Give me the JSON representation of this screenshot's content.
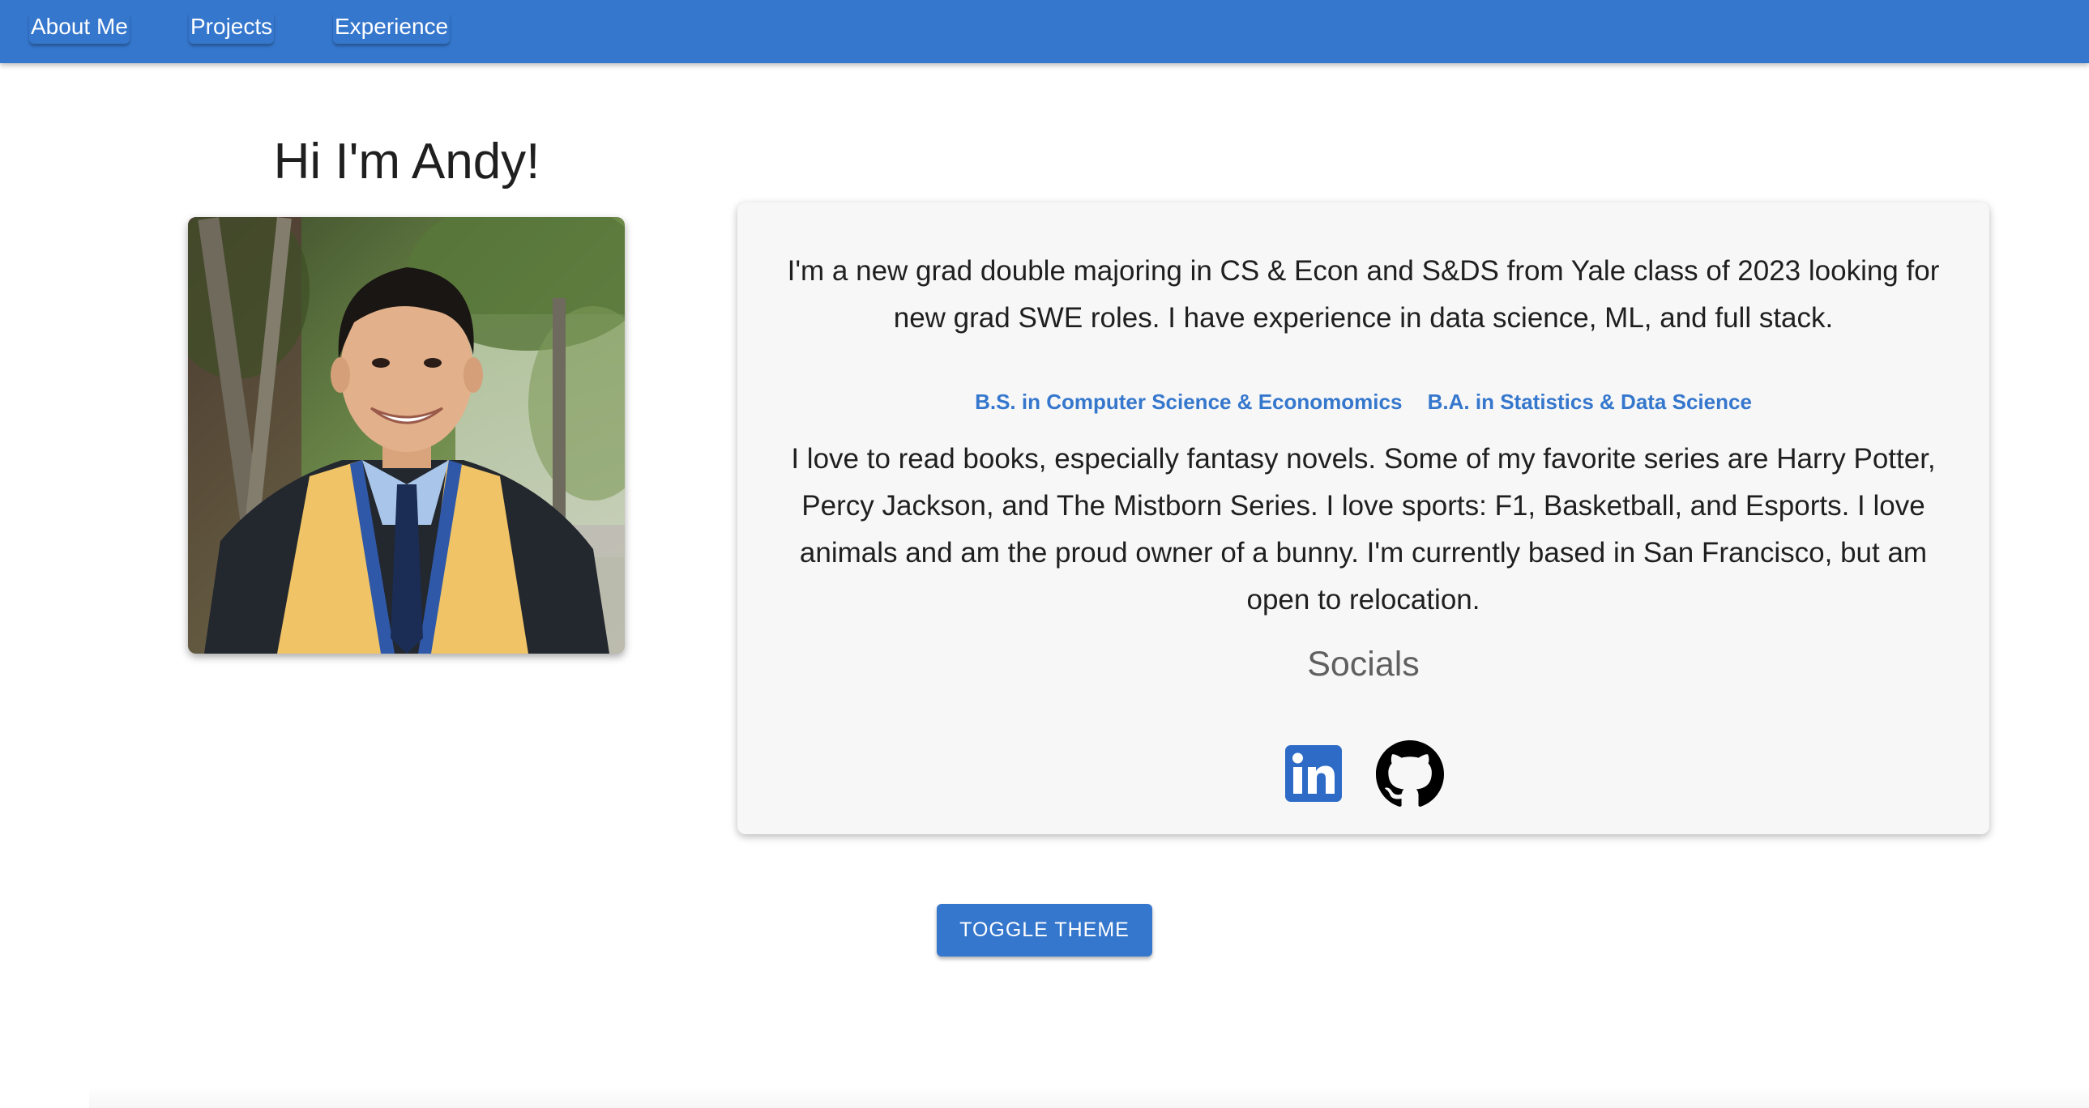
{
  "nav": {
    "items": [
      {
        "label": "About Me"
      },
      {
        "label": "Projects"
      },
      {
        "label": "Experience"
      }
    ]
  },
  "profile": {
    "greeting": "Hi I'm Andy!",
    "photo_alt": "Graduation portrait"
  },
  "about": {
    "intro": "I'm a new grad double majoring in CS & Econ and S&DS from Yale class of 2023 looking for new grad SWE roles. I have experience in data science, ML, and full stack.",
    "degrees": [
      "B.S. in Computer Science & Economomics",
      "B.A. in Statistics & Data Science"
    ],
    "bio": "I love to read books, especially fantasy novels. Some of my favorite series are Harry Potter, Percy Jackson, and The Mistborn Series. I love sports: F1, Basketball, and Esports. I love animals and am the proud owner of a bunny. I'm currently based in San Francisco, but am open to relocation.",
    "socials_title": "Socials",
    "socials": [
      {
        "icon": "linkedin-icon",
        "color": "#2e6bc7"
      },
      {
        "icon": "github-icon",
        "color": "#000000"
      }
    ]
  },
  "actions": {
    "toggle_theme_label": "TOGGLE THEME"
  },
  "colors": {
    "primary": "#3577cd",
    "card_background": "#f7f7f7",
    "text": "#1f1f1f",
    "muted_text": "#606060"
  }
}
